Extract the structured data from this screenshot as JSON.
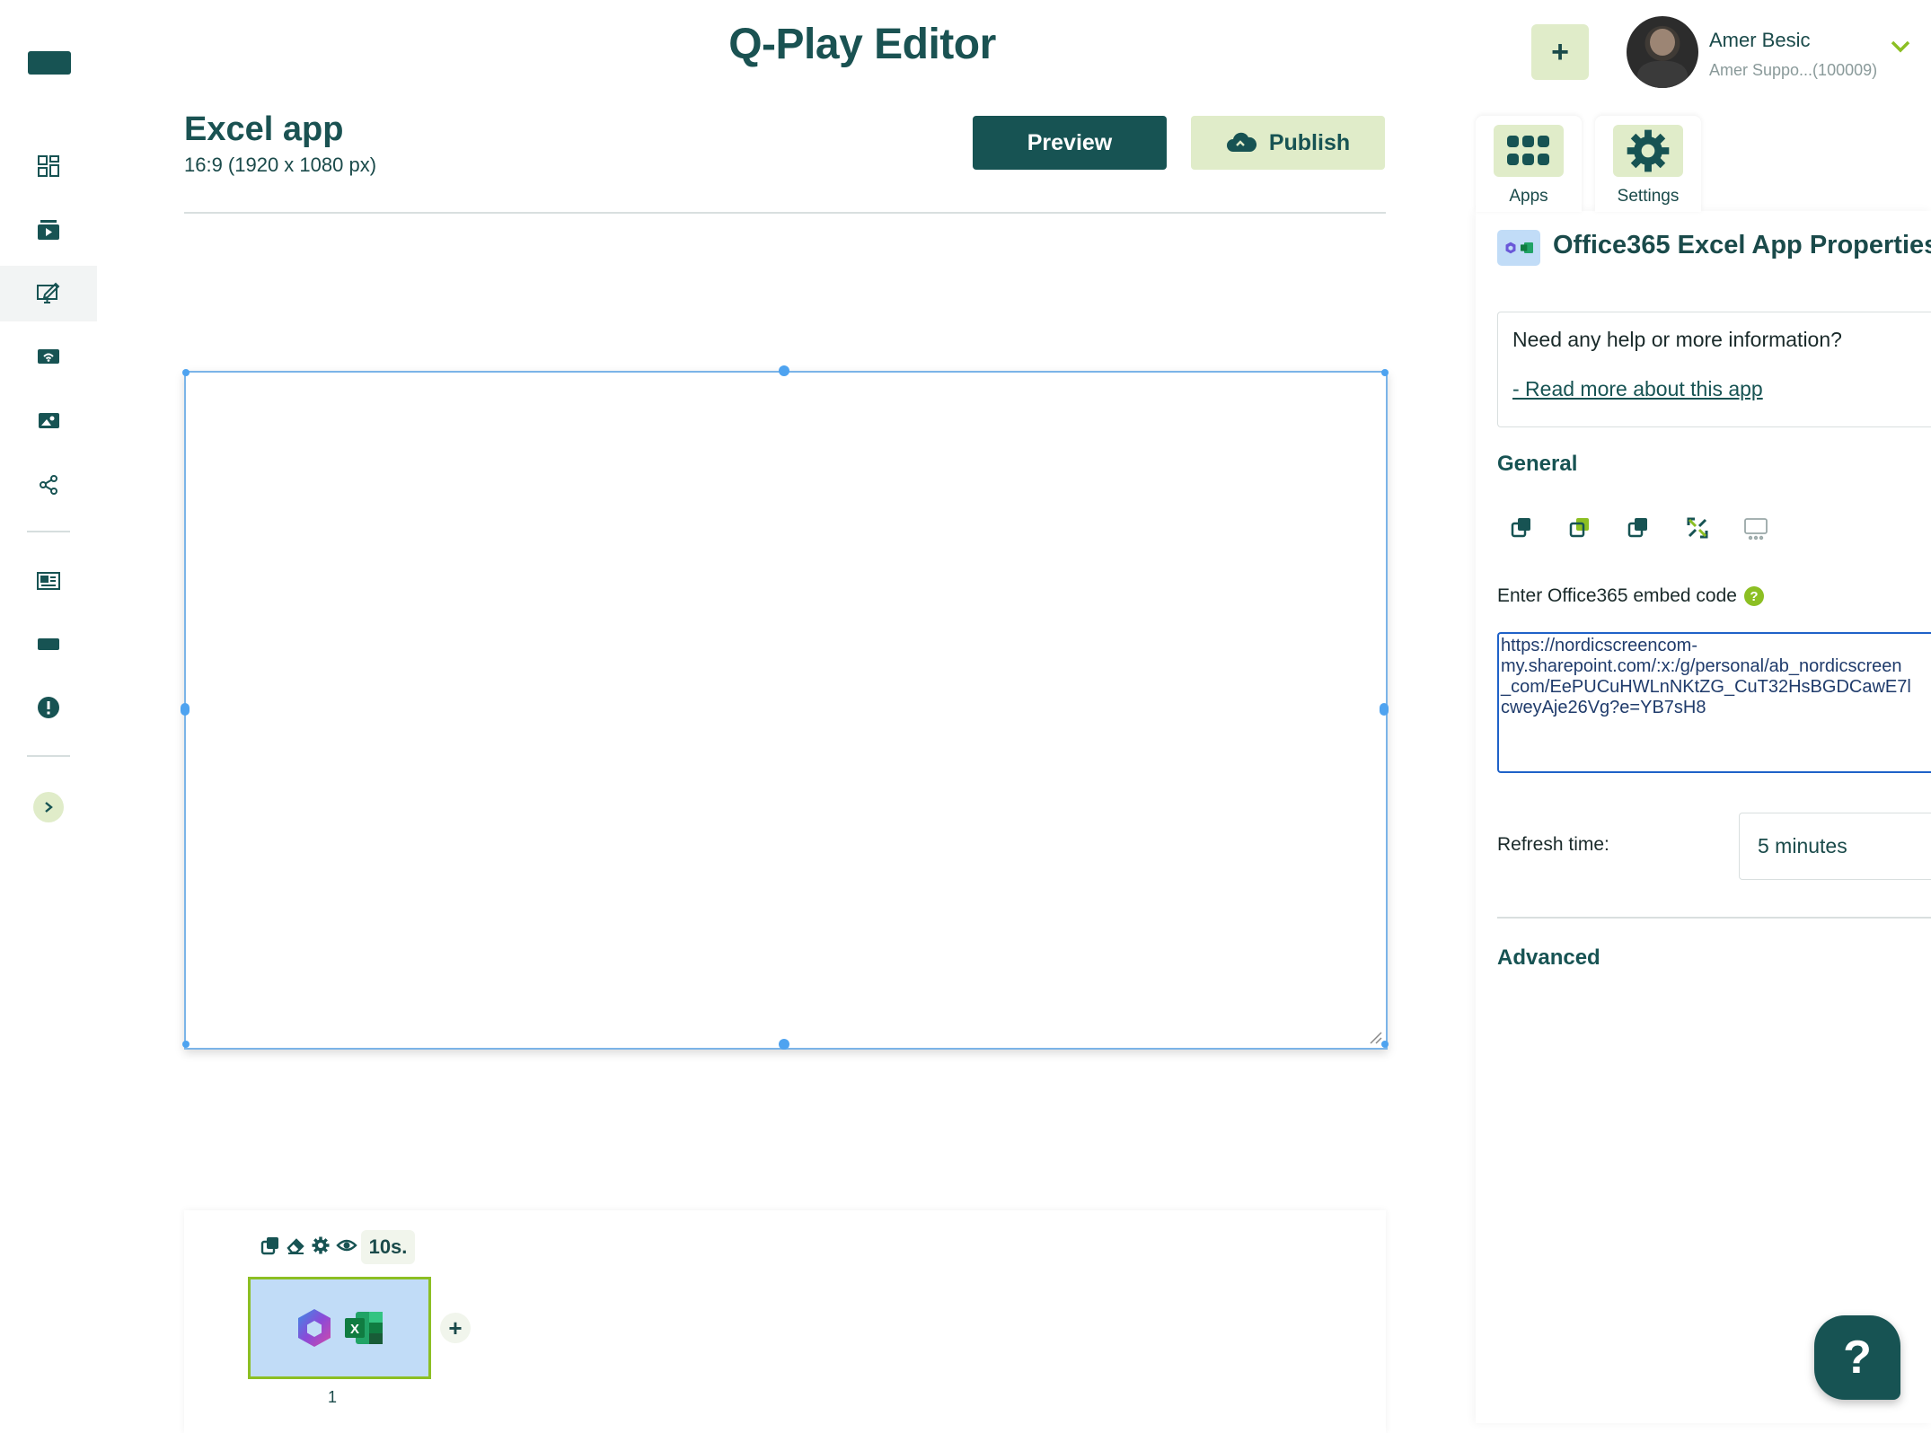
{
  "header": {
    "app_title": "Q-Play Editor",
    "add_label": "+",
    "user_name": "Amer Besic",
    "user_sub": "Amer Suppo...(100009)"
  },
  "sidebar": {
    "items": [
      {
        "icon": "dashboard-icon"
      },
      {
        "icon": "media-icon"
      },
      {
        "icon": "editor-icon",
        "active": true
      },
      {
        "icon": "screens-icon"
      },
      {
        "icon": "gallery-icon"
      },
      {
        "icon": "share-icon"
      },
      {
        "icon": "news-icon"
      },
      {
        "icon": "display-icon"
      },
      {
        "icon": "alert-icon"
      },
      {
        "icon": "expand-icon"
      }
    ]
  },
  "document": {
    "title": "Excel app",
    "resolution": "16:9 (1920 x 1080 px)",
    "preview_label": "Preview",
    "publish_label": "Publish"
  },
  "timeline": {
    "duration": "10s.",
    "slide_number": "1",
    "add_label": "+"
  },
  "panel": {
    "tabs": [
      {
        "label": "Apps",
        "icon": "apps-grid-icon"
      },
      {
        "label": "Settings",
        "icon": "gear-icon"
      }
    ],
    "title": "Office365 Excel App Properties",
    "help_question": "Need any help or more information?",
    "help_link": "- Read more about this app",
    "general_heading": "General",
    "embed_label": "Enter Office365 embed code",
    "embed_value": "https://nordicscreencom-\nmy.sharepoint.com/:x:/g/personal/ab_nordicscreen\n_com/EePUCuHWLnNKtZG_CuT32HsBGDCawE7l\ncweyAje26Vg?e=YB7sH8",
    "refresh_label": "Refresh time:",
    "refresh_value": "5 minutes",
    "advanced_heading": "Advanced"
  },
  "help_fab": "?",
  "colors": {
    "primary": "#175353",
    "accent_light": "#e0ecc9",
    "accent_green": "#8cbf23",
    "selection_blue": "#4ea3f0"
  }
}
